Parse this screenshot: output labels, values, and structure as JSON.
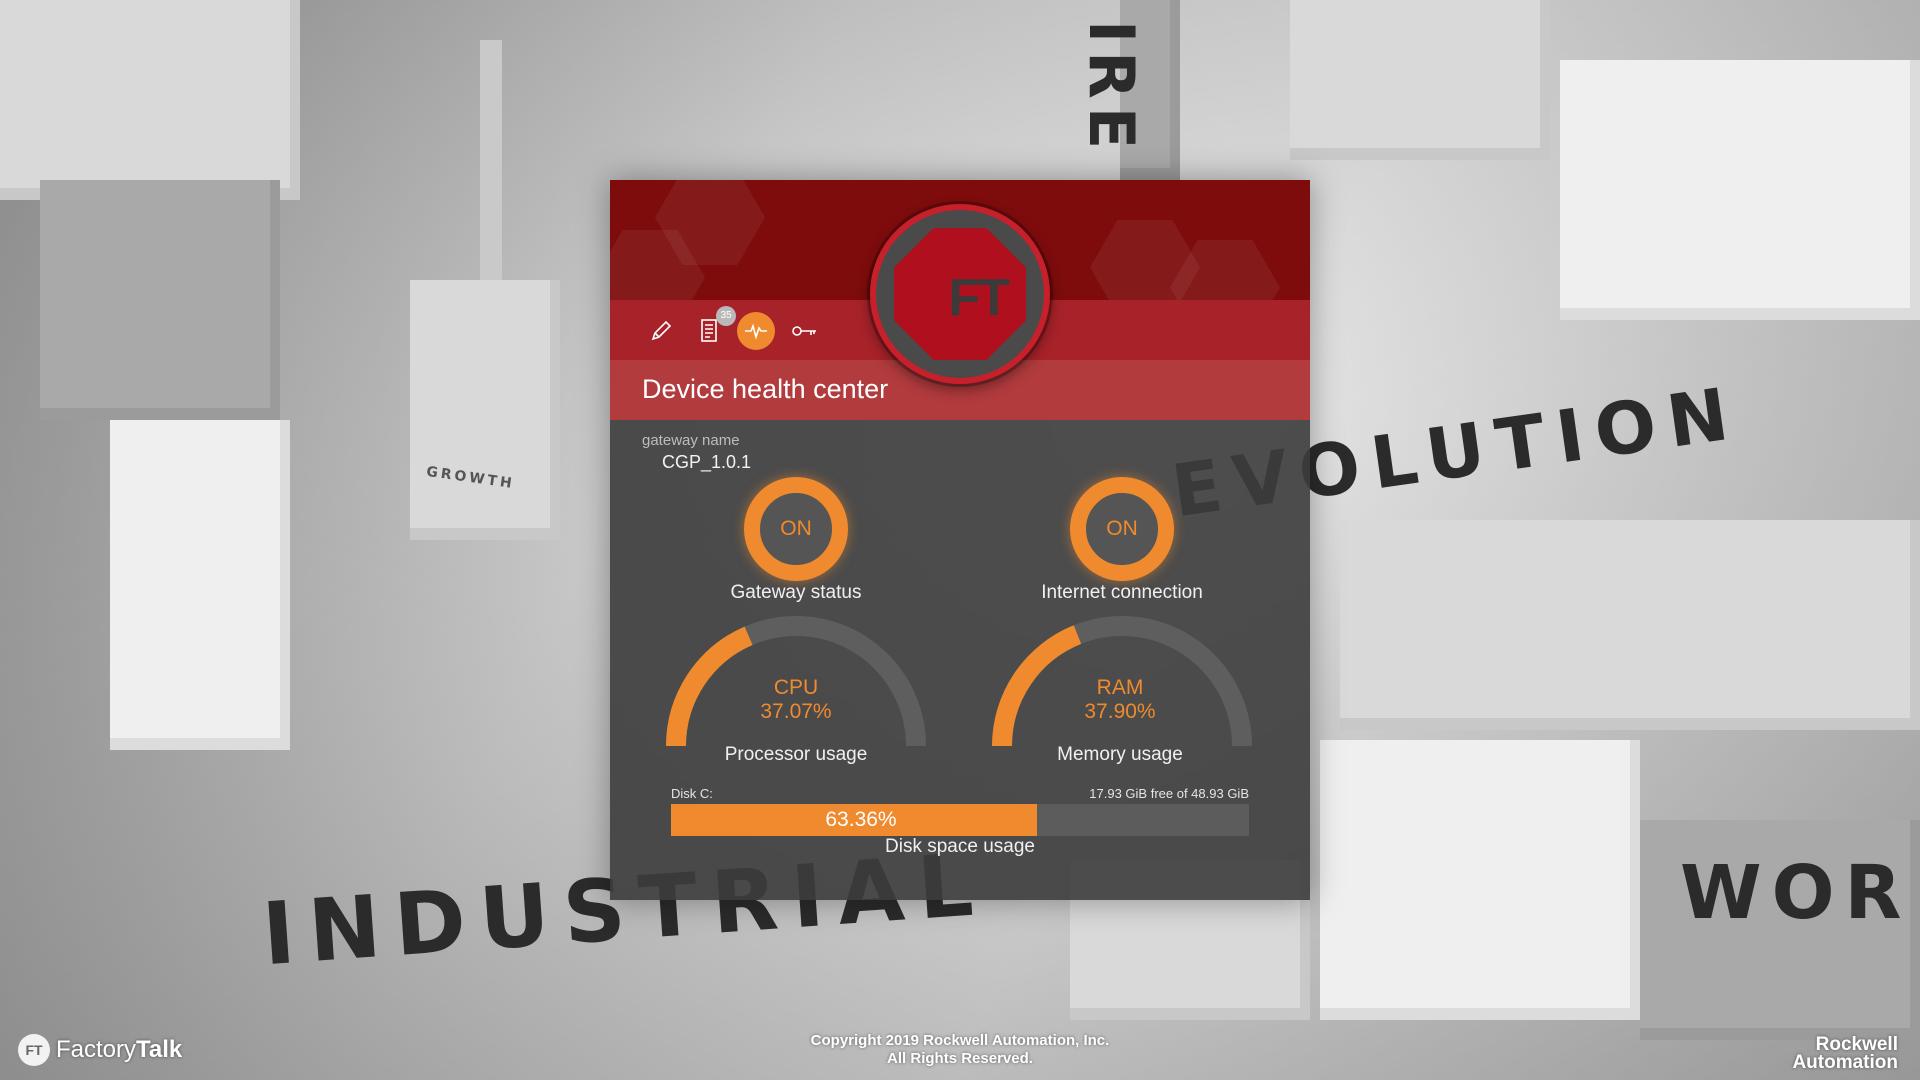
{
  "panel": {
    "title": "Device health center",
    "toolbar": {
      "edit_icon": "pencil-icon",
      "log_icon": "scroll-list-icon",
      "log_badge": "35",
      "health_icon": "pulse-icon",
      "key_icon": "key-icon"
    },
    "logo_text": "FT",
    "gateway": {
      "label": "gateway name",
      "value": "CGP_1.0.1"
    },
    "statuses": [
      {
        "state": "ON",
        "label": "Gateway status"
      },
      {
        "state": "ON",
        "label": "Internet connection"
      }
    ],
    "gauges": [
      {
        "name": "CPU",
        "value_text": "37.07%",
        "value": 37.07,
        "label": "Processor usage"
      },
      {
        "name": "RAM",
        "value_text": "37.90%",
        "value": 37.9,
        "label": "Memory usage"
      }
    ],
    "disk": {
      "name": "Disk C:",
      "free_text": "17.93 GiB free of 48.93 GiB",
      "percent_text": "63.36%",
      "percent": 63.36,
      "label": "Disk space usage"
    }
  },
  "background_words": [
    "INDUSTRIAL",
    "EVOLUTION",
    "WOR",
    "IRE",
    "GROWTH"
  ],
  "footer": {
    "brand_light": "Factory",
    "brand_bold": "Talk",
    "brand_mark": "FT",
    "copyright_line1": "Copyright 2019 Rockwell Automation, Inc.",
    "copyright_line2": "All Rights Reserved.",
    "company_line1": "Rockwell",
    "company_line2": "Automation"
  },
  "colors": {
    "accent": "#ef8a2e",
    "header_red": "#a8222a",
    "panel_bg": "#3c3c3c"
  }
}
